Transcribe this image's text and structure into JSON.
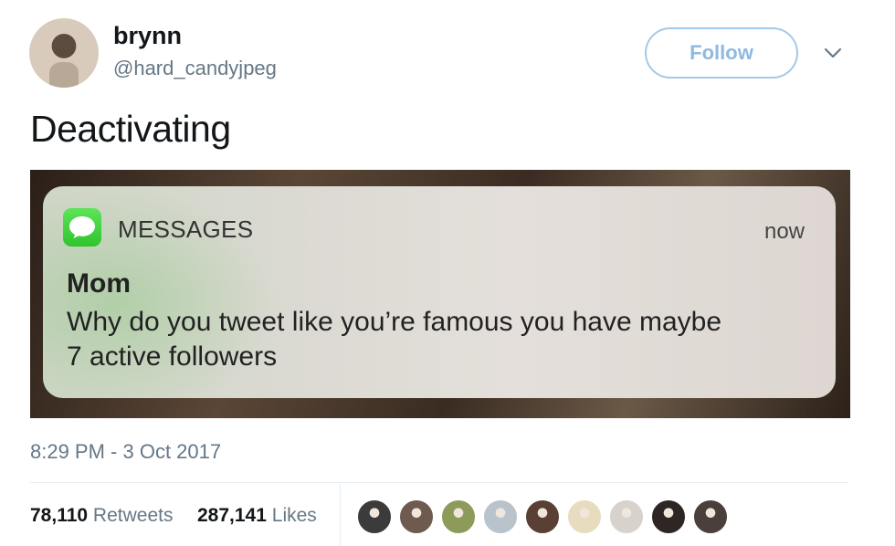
{
  "user": {
    "display_name": "brynn",
    "handle": "@hard_candyjpeg"
  },
  "actions": {
    "follow_label": "Follow",
    "menu_icon": "chevron-down-icon"
  },
  "tweet": {
    "text": "Deactivating",
    "timestamp": "8:29 PM - 3 Oct 2017"
  },
  "notification": {
    "app_icon": "messages-icon",
    "app_name": "MESSAGES",
    "time": "now",
    "sender": "Mom",
    "body_line1": "Why do you tweet like you’re famous you have maybe",
    "body_line2": "7 active followers"
  },
  "stats": {
    "retweets_count": "78,110",
    "retweets_label": "Retweets",
    "likes_count": "287,141",
    "likes_label": "Likes"
  },
  "likers": [
    {
      "color": "#3b3b3b"
    },
    {
      "color": "#6e5a4e"
    },
    {
      "color": "#8c9a5a"
    },
    {
      "color": "#b9c3cc"
    },
    {
      "color": "#5a4034"
    },
    {
      "color": "#e8dcc0"
    },
    {
      "color": "#d8d2cc"
    },
    {
      "color": "#2e2624"
    },
    {
      "color": "#4a3f3a"
    }
  ]
}
